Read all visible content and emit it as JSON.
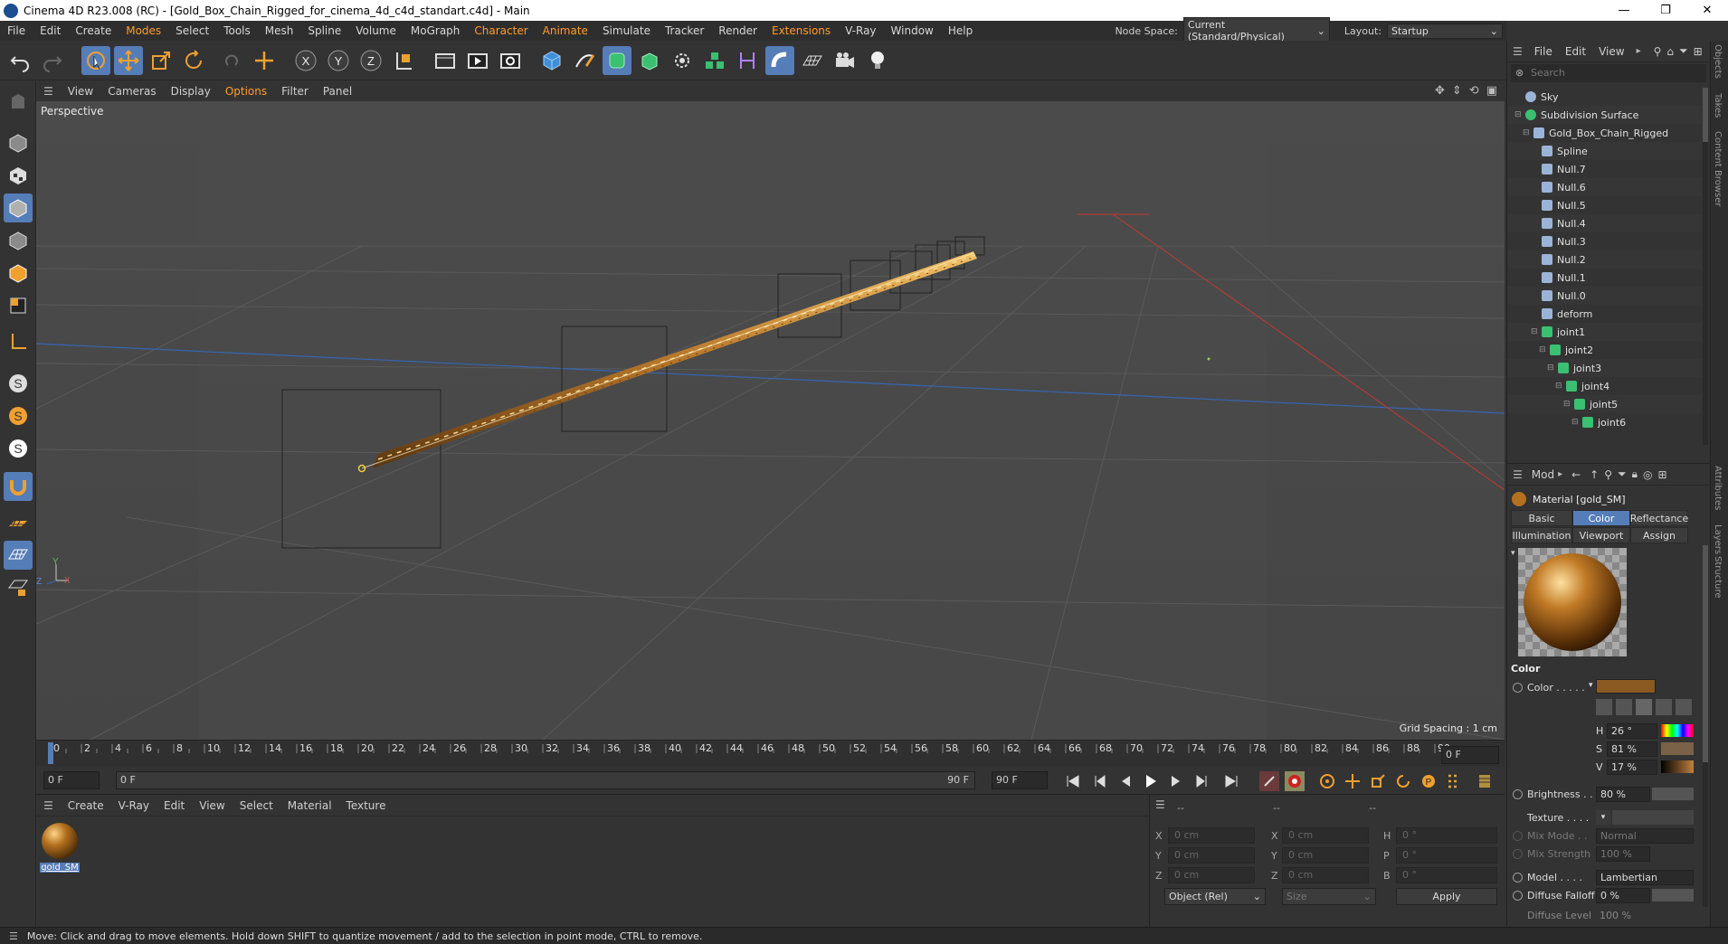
{
  "window": {
    "title": "Cinema 4D R23.008 (RC) - [Gold_Box_Chain_Rigged_for_cinema_4d_c4d_standart.c4d] - Main",
    "controls": [
      "—",
      "❐",
      "✕"
    ]
  },
  "menubar": {
    "items": [
      "File",
      "Edit",
      "Create",
      "Modes",
      "Select",
      "Tools",
      "Mesh",
      "Spline",
      "Volume",
      "MoGraph",
      "Character",
      "Animate",
      "Simulate",
      "Tracker",
      "Render",
      "Extensions",
      "V-Ray",
      "Window",
      "Help"
    ],
    "highlighted": [
      "Modes",
      "Character",
      "Animate",
      "Extensions"
    ],
    "node_space_label": "Node Space:",
    "node_space_value": "Current (Standard/Physical)",
    "layout_label": "Layout:",
    "layout_value": "Startup"
  },
  "toolbar": {
    "icons": [
      "undo-icon",
      "redo-icon",
      "live-selection-icon",
      "move-icon",
      "scale-icon",
      "rotate-icon",
      "recent-tools-icon",
      "add-icon",
      "x-axis-icon",
      "y-axis-icon",
      "z-axis-icon",
      "coordinate-system-icon",
      "render-view-icon",
      "render-picture-viewer-icon",
      "render-settings-icon",
      "cube-icon",
      "pen-icon",
      "subdivision-icon",
      "extrude-icon",
      "cloner-icon",
      "mograph-icon",
      "deformer-icon",
      "bend-icon",
      "floor-icon",
      "camera-icon",
      "light-icon"
    ],
    "axis_labels": [
      "X",
      "Y",
      "Z"
    ]
  },
  "left_tools": {
    "icons": [
      "make-editable-icon",
      "model-mode-icon",
      "texture-mode-icon",
      "object-mode-icon",
      "points-mode-icon",
      "edges-mode-icon",
      "polygons-mode-icon",
      "axis-mode-icon",
      "snap-icon-1",
      "snap-icon-2",
      "snap-icon-3",
      "magnet-icon",
      "workplane-icon",
      "grid-icon",
      "locked-workplane-icon"
    ],
    "snap_letter": "S"
  },
  "viewport": {
    "menu": [
      "View",
      "Cameras",
      "Display",
      "Options",
      "Filter",
      "Panel"
    ],
    "highlighted_menu": "Options",
    "label": "Perspective",
    "grid_spacing": "Grid Spacing : 1 cm",
    "axis_labels": [
      "Y",
      "Z",
      "X"
    ]
  },
  "timeline": {
    "ticks": [
      "0",
      "2",
      "4",
      "6",
      "8",
      "10",
      "12",
      "14",
      "16",
      "18",
      "20",
      "22",
      "24",
      "26",
      "28",
      "30",
      "32",
      "34",
      "36",
      "38",
      "40",
      "42",
      "44",
      "46",
      "48",
      "50",
      "52",
      "54",
      "56",
      "58",
      "60",
      "62",
      "64",
      "66",
      "68",
      "70",
      "72",
      "74",
      "76",
      "78",
      "80",
      "82",
      "84",
      "86",
      "88",
      "90"
    ],
    "current_frame": "0 F",
    "start_field": "0 F",
    "range_start": "0 F",
    "range_end": "90 F",
    "end_field": "90 F"
  },
  "material_manager": {
    "menu": [
      "Create",
      "V-Ray",
      "Edit",
      "View",
      "Select",
      "Material",
      "Texture"
    ],
    "materials": [
      {
        "name": "gold_SM"
      }
    ]
  },
  "coordinates": {
    "headers": [
      "--",
      "--",
      "--"
    ],
    "rows": [
      {
        "a_label": "X",
        "a_val": "0 cm",
        "b_label": "X",
        "b_val": "0 cm",
        "c_label": "H",
        "c_val": "0 °"
      },
      {
        "a_label": "Y",
        "a_val": "0 cm",
        "b_label": "Y",
        "b_val": "0 cm",
        "c_label": "P",
        "c_val": "0 °"
      },
      {
        "a_label": "Z",
        "a_val": "0 cm",
        "b_label": "Z",
        "b_val": "0 cm",
        "c_label": "B",
        "c_val": "0 °"
      }
    ],
    "mode": "Object (Rel)",
    "size": "Size",
    "apply": "Apply"
  },
  "object_manager": {
    "menu": [
      "File",
      "Edit",
      "View"
    ],
    "search_placeholder": "Search",
    "objects": [
      {
        "name": "Sky",
        "depth": 0,
        "type": "sky"
      },
      {
        "name": "Subdivision Surface",
        "depth": 0,
        "type": "subdiv"
      },
      {
        "name": "Gold_Box_Chain_Rigged",
        "depth": 1,
        "type": "null"
      },
      {
        "name": "Spline",
        "depth": 2,
        "type": "spline"
      },
      {
        "name": "Null.7",
        "depth": 2,
        "type": "null"
      },
      {
        "name": "Null.6",
        "depth": 2,
        "type": "null"
      },
      {
        "name": "Null.5",
        "depth": 2,
        "type": "null"
      },
      {
        "name": "Null.4",
        "depth": 2,
        "type": "null"
      },
      {
        "name": "Null.3",
        "depth": 2,
        "type": "null"
      },
      {
        "name": "Null.2",
        "depth": 2,
        "type": "null"
      },
      {
        "name": "Null.1",
        "depth": 2,
        "type": "null"
      },
      {
        "name": "Null.0",
        "depth": 2,
        "type": "null"
      },
      {
        "name": "deform",
        "depth": 2,
        "type": "null"
      },
      {
        "name": "joint1",
        "depth": 2,
        "type": "joint"
      },
      {
        "name": "joint2",
        "depth": 3,
        "type": "joint"
      },
      {
        "name": "joint3",
        "depth": 4,
        "type": "joint"
      },
      {
        "name": "joint4",
        "depth": 5,
        "type": "joint"
      },
      {
        "name": "joint5",
        "depth": 6,
        "type": "joint"
      },
      {
        "name": "joint6",
        "depth": 7,
        "type": "joint"
      }
    ]
  },
  "attributes": {
    "menu_label": "Mod",
    "title": "Material [gold_SM]",
    "tabs_row1": [
      "Basic",
      "Color",
      "Reflectance"
    ],
    "tabs_row2": [
      "Illumination",
      "Viewport",
      "Assign"
    ],
    "active_tab": "Color",
    "section": "Color",
    "color_label": "Color . . . . .",
    "color_swatch": "#8a5a22",
    "h_label": "H",
    "h_value": "26 °",
    "s_label": "S",
    "s_value": "81 %",
    "v_label": "V",
    "v_value": "17 %",
    "brightness_label": "Brightness . .",
    "brightness_value": "80 %",
    "texture_label": "Texture . . . .",
    "mix_mode_label": "Mix Mode . .",
    "mix_mode_value": "Normal",
    "mix_strength_label": "Mix Strength",
    "mix_strength_value": "100 %",
    "model_label": "Model . . . .",
    "model_value": "Lambertian",
    "diffuse_falloff_label": "Diffuse Falloff",
    "diffuse_falloff_value": "0 %",
    "diffuse_level_label": "Diffuse Level",
    "diffuse_level_value": "100 %"
  },
  "right_strip_tabs": [
    "Objects",
    "Takes",
    "Content Browser",
    "Attributes",
    "Layers",
    "Structure"
  ],
  "status": "Move: Click and drag to move elements. Hold down SHIFT to quantize movement / add to the selection in point mode, CTRL to remove.",
  "colors": {
    "accent": "#557db7",
    "highlight_menu": "#ff9d2a",
    "gold": "#b8782a",
    "viewport_bg": "#4a4a4a"
  }
}
